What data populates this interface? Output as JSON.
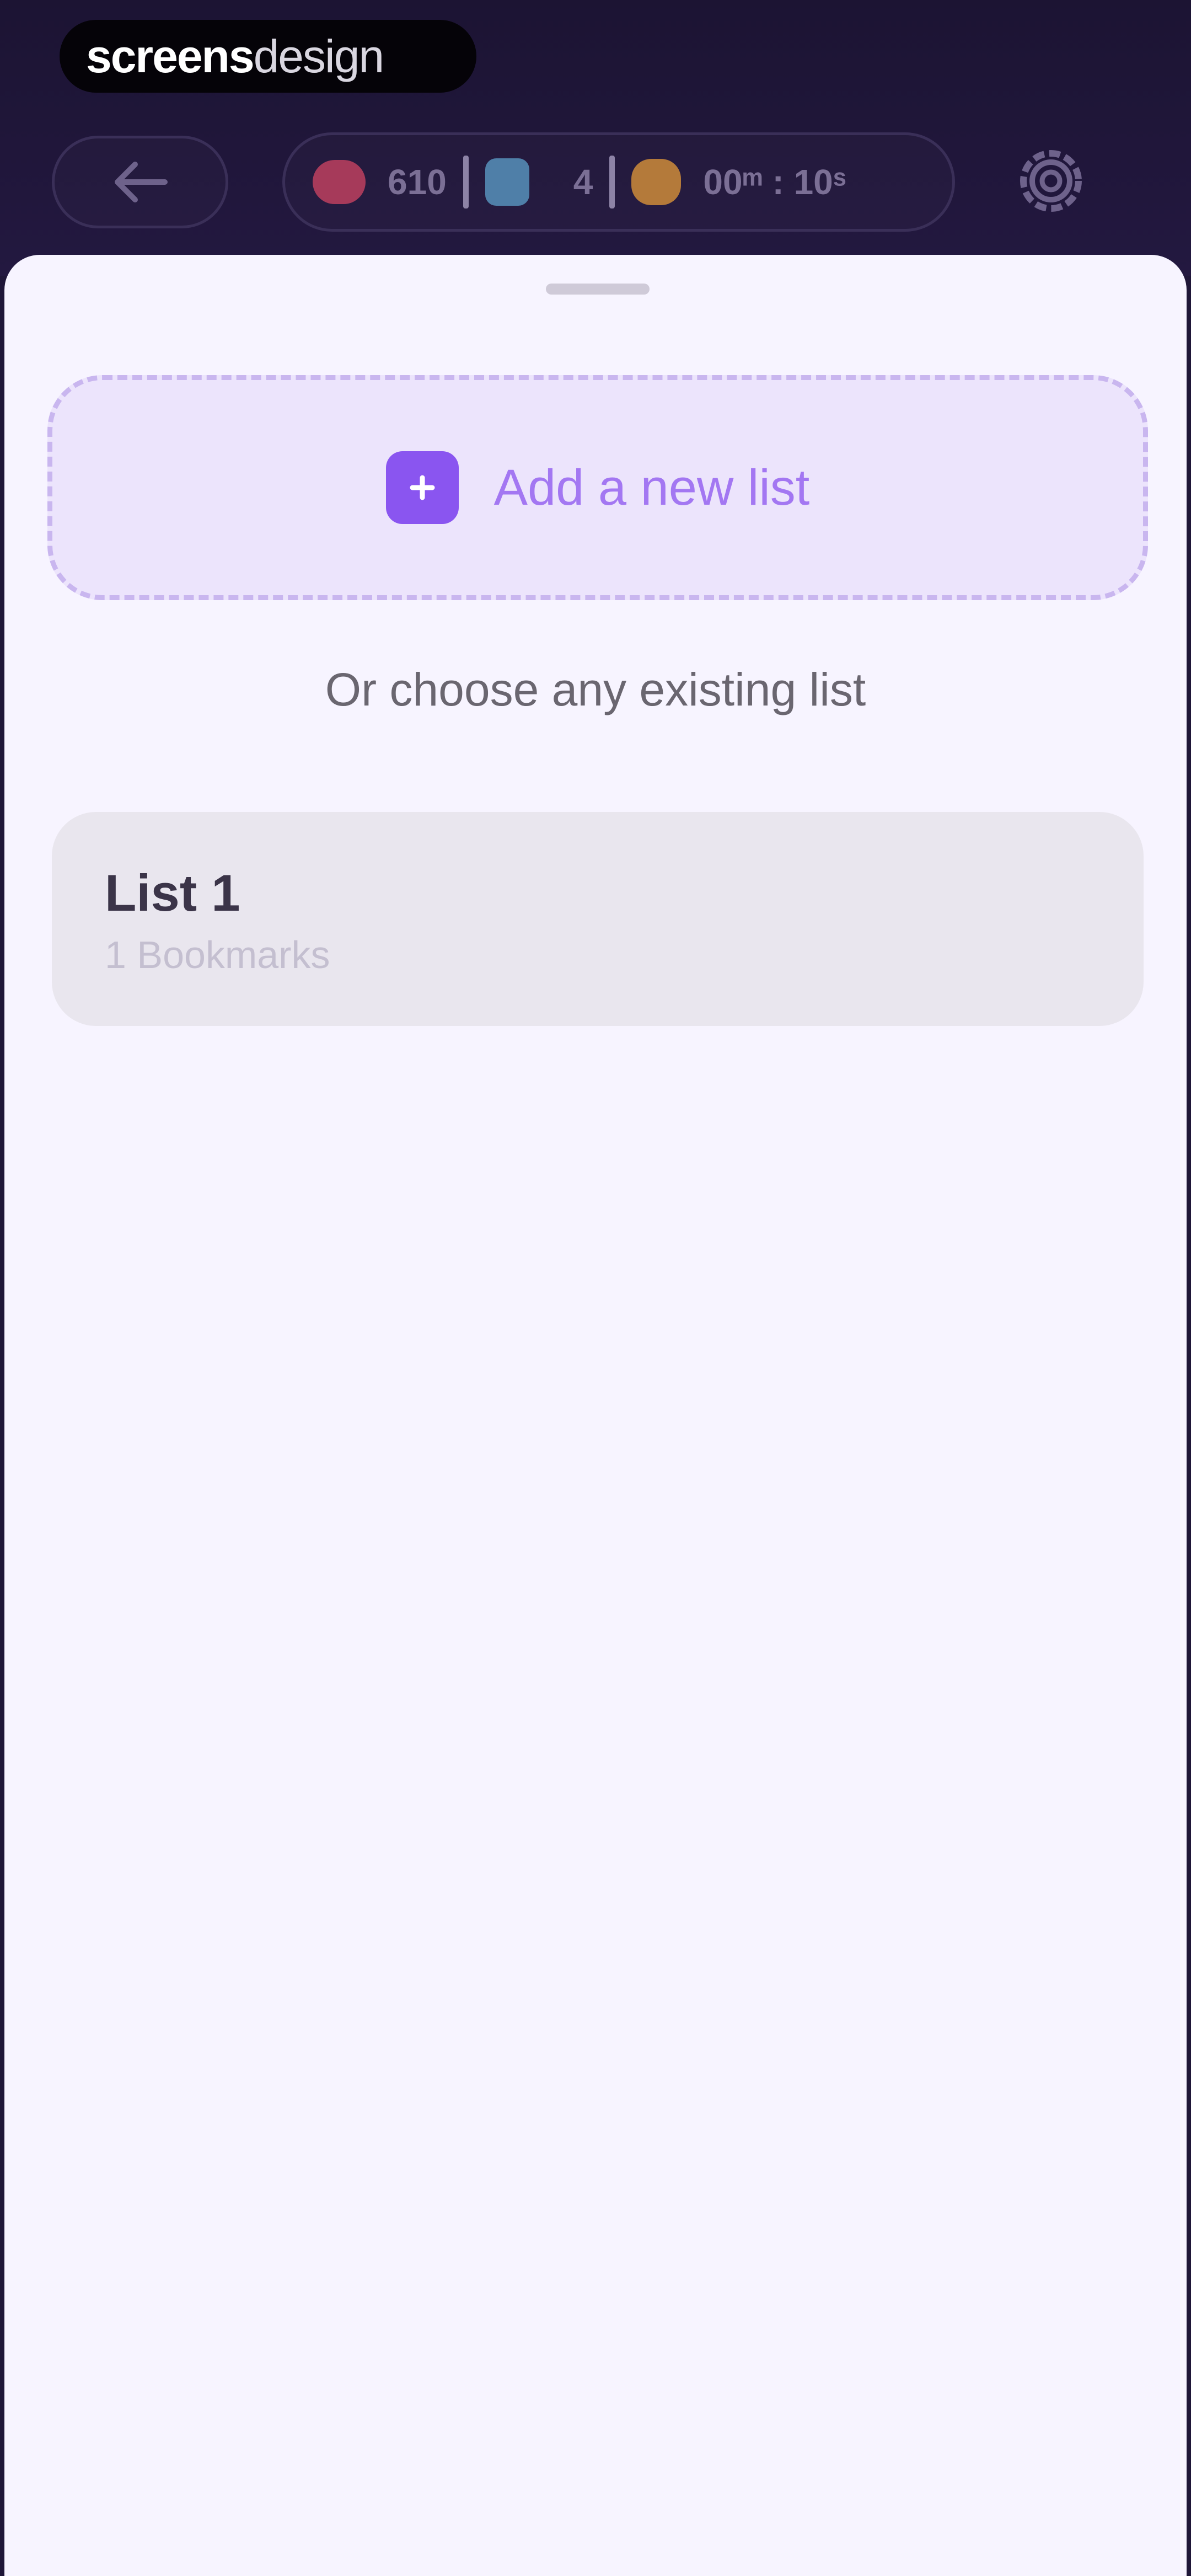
{
  "logo": {
    "part1": "screens",
    "part2": "design"
  },
  "header": {
    "stats": [
      {
        "icon": "brain-icon",
        "value": "610",
        "color": "#a63a5a"
      },
      {
        "icon": "gem-icon",
        "value": "4",
        "color": "#4f7fa8"
      },
      {
        "icon": "clock-icon",
        "value": "00ᵐ : 10ˢ",
        "color": "#b47a3a"
      }
    ]
  },
  "sheet": {
    "add_label": "Add a new list",
    "choose_text": "Or choose any existing list",
    "lists": [
      {
        "name": "List 1",
        "count": "1 Bookmarks"
      }
    ]
  },
  "colors": {
    "accent": "#8a55f0",
    "header_bg": "#1f1638",
    "sheet_bg": "#f7f4ff"
  }
}
